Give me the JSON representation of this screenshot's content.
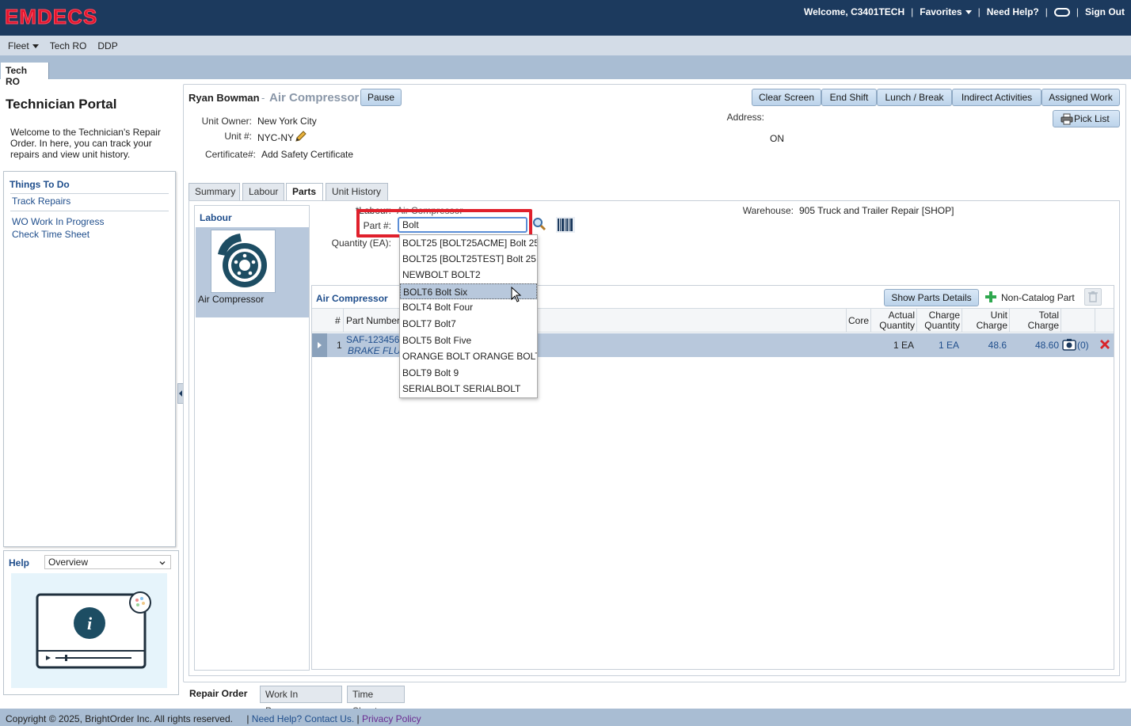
{
  "app": {
    "logo": "EMDECS",
    "welcome": "Welcome, C3401TECH",
    "favorites": "Favorites",
    "need_help": "Need Help?",
    "sign_out": "Sign Out"
  },
  "menu": {
    "fleet": "Fleet",
    "tech_ro": "Tech RO",
    "ddp": "DDP"
  },
  "page_tab": "Tech RO",
  "sidebar": {
    "title": "Technician Portal",
    "welcome": "Welcome to the Technician's Repair Order. In here, you can track your repairs and view unit history.",
    "things_to_do": "Things To Do",
    "links": [
      "Track Repairs",
      "WO Work In Progress",
      "Check Time Sheet"
    ],
    "help_label": "Help",
    "help_option": "Overview"
  },
  "header": {
    "technician": "Ryan Bowman",
    "dash": "-",
    "activity": "Air Compressor",
    "pause": "Pause",
    "buttons": [
      "Clear Screen",
      "End Shift",
      "Lunch / Break",
      "Indirect Activities",
      "Assigned Work"
    ],
    "pick_list": "Pick List",
    "unit_owner_label": "Unit Owner:",
    "unit_owner": "New York City",
    "unit_label": "Unit #:",
    "unit": "NYC-NY",
    "cert_label": "Certificate#:",
    "cert_link": "Add Safety Certificate",
    "address_label": "Address:",
    "address": "ON"
  },
  "tabs": [
    "Summary",
    "Labour",
    "Parts",
    "Unit History"
  ],
  "active_tab": "Parts",
  "parts": {
    "labour_heading": "Labour",
    "labour_item": "Air Compressor",
    "labour_label": "*Labour:",
    "labour_value": "Air Compressor",
    "part_label": "Part #:",
    "part_value": "Bolt",
    "quantity_label": "Quantity (EA):",
    "warehouse_label": "Warehouse:",
    "warehouse": "905 Truck and Trailer Repair [SHOP]"
  },
  "suggestions": [
    "BOLT25 [BOLT25ACME] Bolt 25",
    "BOLT25 [BOLT25TEST] Bolt 25",
    "NEWBOLT BOLT2",
    "BOLT6 Bolt Six",
    "BOLT4 Bolt Four",
    "BOLT7 Bolt7",
    "BOLT5 Bolt Five",
    "ORANGE BOLT ORANGE BOLT",
    "BOLT9 Bolt 9",
    "SERIALBOLT SERIALBOLT"
  ],
  "highlighted_suggestion": "BOLT6 Bolt Six",
  "grid": {
    "title": "Air Compressor",
    "show_details": "Show Parts Details",
    "non_catalog": "Non-Catalog Part",
    "columns": {
      "num": "#",
      "part_number": "Part Number",
      "core": "Core",
      "actual_qty_1": "Actual",
      "actual_qty_2": "Quantity",
      "charge_qty_1": "Charge",
      "charge_qty_2": "Quantity",
      "unit_charge_1": "Unit",
      "unit_charge_2": "Charge",
      "total_charge_1": "Total",
      "total_charge_2": "Charge"
    },
    "row": {
      "num": "1",
      "part_number": "SAF-123456",
      "description": "BRAKE FLUID",
      "actual_qty": "1 EA",
      "charge_qty": "1 EA",
      "unit_charge": "48.6",
      "total_charge": "48.60",
      "photo_count": "(0)"
    }
  },
  "bottom_tabs": [
    "Repair Order",
    "Work In Progress",
    "Time Sheet"
  ],
  "footer": {
    "copyright": "Copyright © 2025, BrightOrder Inc. All rights reserved.",
    "help_link": "Need Help? Contact Us.",
    "privacy": "Privacy Policy"
  },
  "colors": {
    "topbar": "#1c3a5e",
    "logo": "#e2142d",
    "link": "#1f4e8c",
    "highlight": "#e0202c",
    "selection": "#b8c8dc"
  }
}
